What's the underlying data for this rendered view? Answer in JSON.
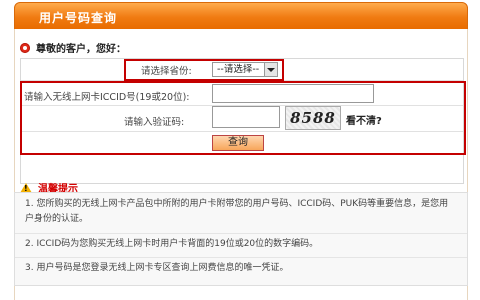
{
  "header": {
    "title": "用户号码查询"
  },
  "greeting": "尊敬的客户，您好：",
  "form": {
    "province_label": "请选择省份:",
    "province_select_value": "--请选择--",
    "iccid_label": "请输入无线上网卡ICCID号(19或20位):",
    "iccid_value": "",
    "verify_label": "请输入验证码:",
    "verify_value": "",
    "captcha_text": "8588",
    "refresh_link": "看不清?",
    "submit_label": "查询"
  },
  "tips": {
    "title": "温馨提示",
    "items": [
      "1. 您所购买的无线上网卡产品包中所附的用户卡附带您的用户号码、ICCID码、PUK码等重要信息，是您用户身份的认证。",
      "2. ICCID码为您购买无线上网卡时用户卡背面的19位或20位的数字编码。",
      "3. 用户号码是您登录无线上网卡专区查询上网费信息的唯一凭证。"
    ]
  },
  "colors": {
    "accent": "#f07b12",
    "highlight": "#c40000",
    "tip_title": "#d40000"
  }
}
